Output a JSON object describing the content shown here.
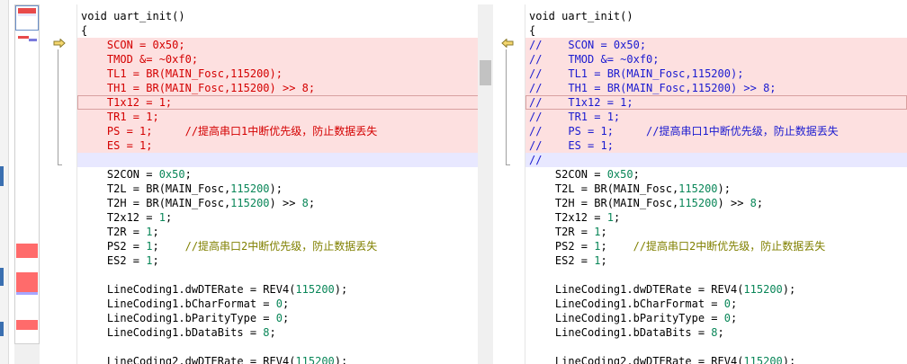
{
  "left_pane": {
    "lines": [
      {
        "text": "void uart_init()",
        "style": "normal"
      },
      {
        "text": "{",
        "style": "normal"
      },
      {
        "text": "    SCON = 0x50;",
        "style": "del"
      },
      {
        "text": "    TMOD &= ~0xf0;",
        "style": "del"
      },
      {
        "text": "    TL1 = BR(MAIN_Fosc,115200);",
        "style": "del"
      },
      {
        "text": "    TH1 = BR(MAIN_Fosc,115200) >> 8;",
        "style": "del"
      },
      {
        "text": "    T1x12 = 1;",
        "style": "del-cur"
      },
      {
        "text": "    TR1 = 1;",
        "style": "del"
      },
      {
        "text": "    PS = 1;     //提高串口1中断优先级，防止数据丢失",
        "style": "del"
      },
      {
        "text": "    ES = 1;",
        "style": "del"
      },
      {
        "text": "",
        "style": "empty"
      },
      {
        "text": "    S2CON = 0x50;",
        "style": "normal"
      },
      {
        "text": "    T2L = BR(MAIN_Fosc,115200);",
        "style": "normal"
      },
      {
        "text": "    T2H = BR(MAIN_Fosc,115200) >> 8;",
        "style": "normal"
      },
      {
        "text": "    T2x12 = 1;",
        "style": "normal"
      },
      {
        "text": "    T2R = 1;",
        "style": "normal"
      },
      {
        "text": "    PS2 = 1;    //提高串口2中断优先级，防止数据丢失",
        "style": "normal"
      },
      {
        "text": "    ES2 = 1;",
        "style": "normal"
      },
      {
        "text": "",
        "style": "normal"
      },
      {
        "text": "    LineCoding1.dwDTERate = REV4(115200);",
        "style": "normal"
      },
      {
        "text": "    LineCoding1.bCharFormat = 0;",
        "style": "normal"
      },
      {
        "text": "    LineCoding1.bParityType = 0;",
        "style": "normal"
      },
      {
        "text": "    LineCoding1.bDataBits = 8;",
        "style": "normal"
      },
      {
        "text": "",
        "style": "normal"
      },
      {
        "text": "    LineCoding2.dwDTERate = REV4(115200);",
        "style": "normal"
      }
    ]
  },
  "right_pane": {
    "lines": [
      {
        "text": "void uart_init()",
        "style": "normal"
      },
      {
        "text": "{",
        "style": "normal"
      },
      {
        "text": "//    SCON = 0x50;",
        "style": "add"
      },
      {
        "text": "//    TMOD &= ~0xf0;",
        "style": "add"
      },
      {
        "text": "//    TL1 = BR(MAIN_Fosc,115200);",
        "style": "add"
      },
      {
        "text": "//    TH1 = BR(MAIN_Fosc,115200) >> 8;",
        "style": "add"
      },
      {
        "text": "//    T1x12 = 1;",
        "style": "add-cur"
      },
      {
        "text": "//    TR1 = 1;",
        "style": "add"
      },
      {
        "text": "//    PS = 1;     //提高串口1中断优先级，防止数据丢失",
        "style": "add"
      },
      {
        "text": "//    ES = 1;",
        "style": "add"
      },
      {
        "text": "//",
        "style": "add-empty"
      },
      {
        "text": "    S2CON = 0x50;",
        "style": "normal"
      },
      {
        "text": "    T2L = BR(MAIN_Fosc,115200);",
        "style": "normal"
      },
      {
        "text": "    T2H = BR(MAIN_Fosc,115200) >> 8;",
        "style": "normal"
      },
      {
        "text": "    T2x12 = 1;",
        "style": "normal"
      },
      {
        "text": "    T2R = 1;",
        "style": "normal"
      },
      {
        "text": "    PS2 = 1;    //提高串口2中断优先级，防止数据丢失",
        "style": "normal"
      },
      {
        "text": "    ES2 = 1;",
        "style": "normal"
      },
      {
        "text": "",
        "style": "normal"
      },
      {
        "text": "    LineCoding1.dwDTERate = REV4(115200);",
        "style": "normal"
      },
      {
        "text": "    LineCoding1.bCharFormat = 0;",
        "style": "normal"
      },
      {
        "text": "    LineCoding1.bParityType = 0;",
        "style": "normal"
      },
      {
        "text": "    LineCoding1.bDataBits = 8;",
        "style": "normal"
      },
      {
        "text": "",
        "style": "normal"
      },
      {
        "text": "    LineCoding2.dwDTERate = REV4(115200);",
        "style": "normal"
      }
    ]
  },
  "icons": {
    "left_change_marker": "arrow-right-icon",
    "right_change_marker": "arrow-left-icon"
  },
  "colors": {
    "changed_line_bg": "#fde0e0",
    "empty_line_bg": "#e8e8ff",
    "deleted_text": "#d40000",
    "added_text": "#1a1ad0",
    "comment_text": "#808000",
    "number_text": "#098658",
    "marker_fill": "#f5d76e"
  }
}
